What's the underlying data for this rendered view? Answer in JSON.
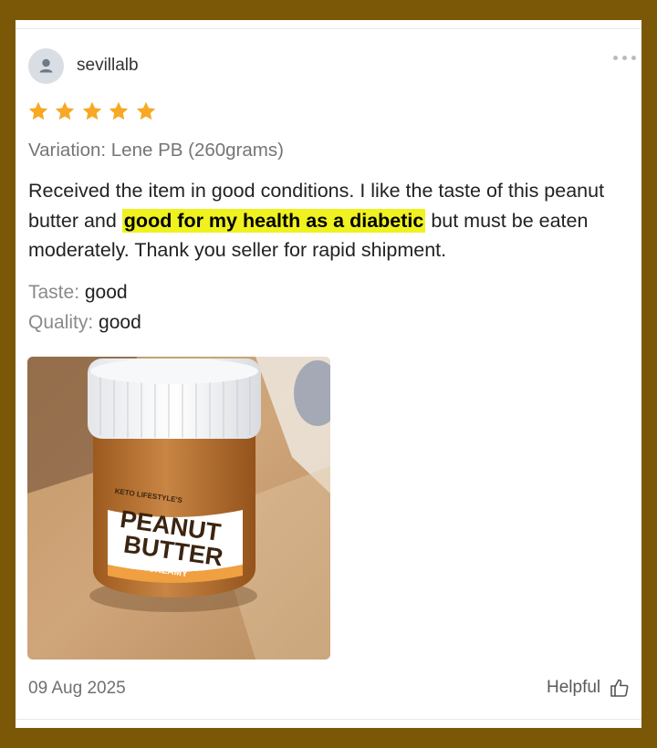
{
  "review": {
    "user": {
      "name": "sevillalb",
      "avatar_icon": "person-icon"
    },
    "more_icon": "more-horizontal-icon",
    "rating": {
      "value": 5,
      "max": 5,
      "color": "#f7a825"
    },
    "variation": "Variation: Lene PB (260grams)",
    "text": {
      "before": "Received the item in good conditions. I like the taste of this peanut butter and ",
      "highlight": "good for my health as a diabetic",
      "after": " but must be eaten moderately. Thank you seller for rapid shipment."
    },
    "highlight_color": "#eff21f",
    "attributes": [
      {
        "label": "Taste:",
        "value": "good"
      },
      {
        "label": "Quality:",
        "value": "good"
      }
    ],
    "photo": {
      "brand": "KETO LIFESTYLE'S",
      "title_line1": "PEANUT",
      "title_line2": "BUTTER",
      "flavor": "CREAMY"
    },
    "date": "09 Aug 2025",
    "helpful_label": "Helpful",
    "helpful_icon": "thumbs-up-icon"
  }
}
